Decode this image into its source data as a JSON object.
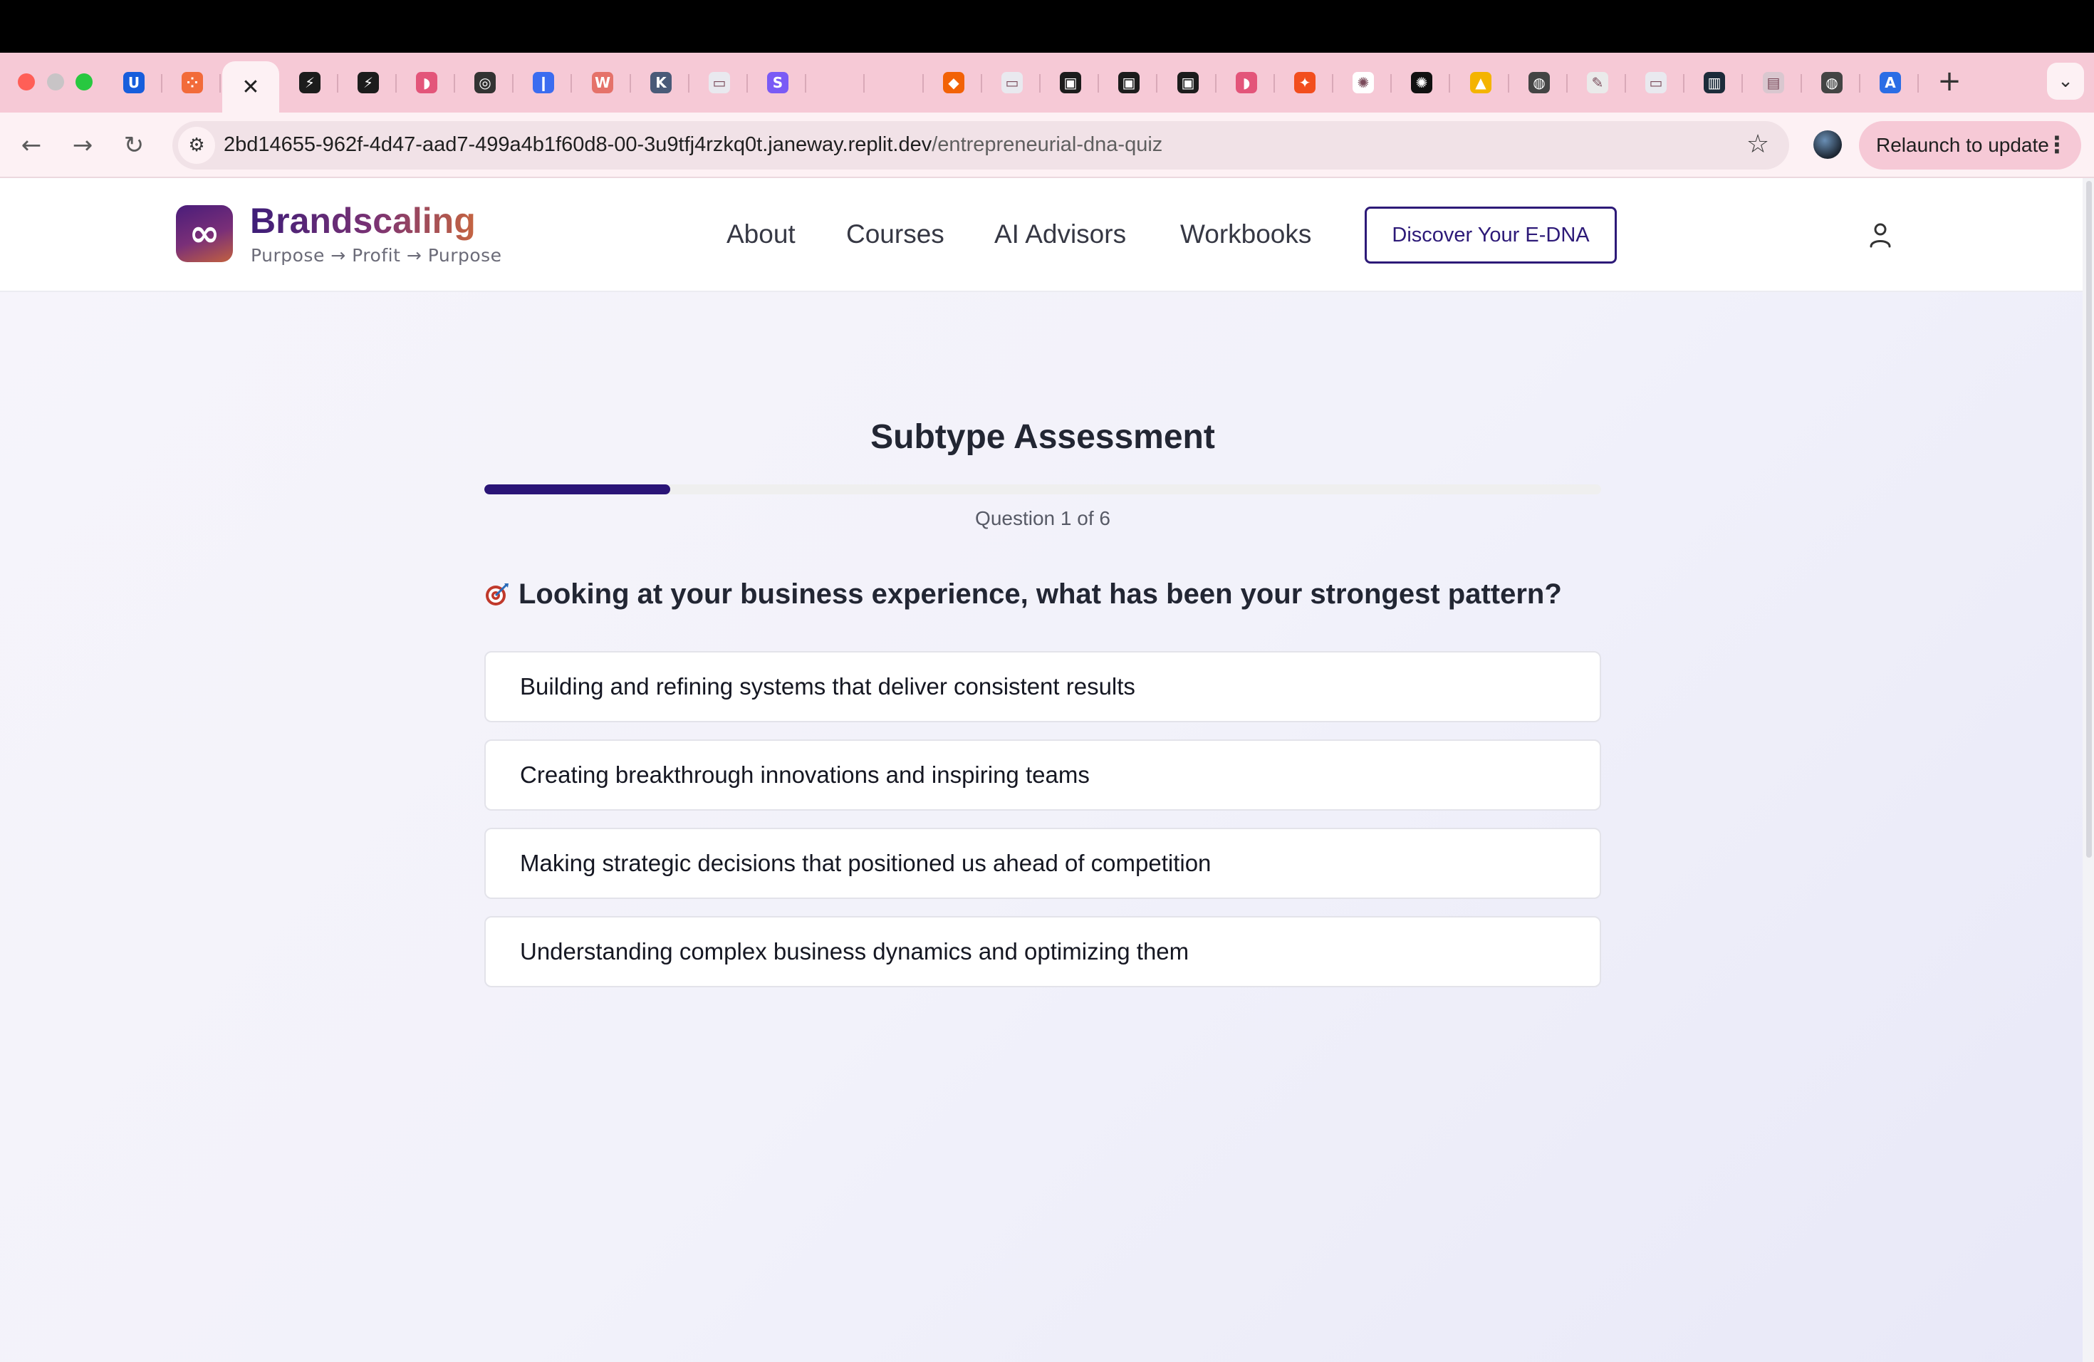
{
  "browser": {
    "tabs": [
      {
        "icon": "bitwarden-icon",
        "color": "#175ddc",
        "glyph": "U"
      },
      {
        "icon": "grid-app-icon",
        "color": "#f26b3a",
        "glyph": "⁘"
      },
      {
        "icon": "close-icon",
        "active": true
      },
      {
        "icon": "bolt-app-icon",
        "color": "#1c1c1c",
        "glyph": "⚡"
      },
      {
        "icon": "bolt-app-icon",
        "color": "#1c1c1c",
        "glyph": "⚡"
      },
      {
        "icon": "shape-app-icon",
        "color": "#e3557a",
        "glyph": "◗"
      },
      {
        "icon": "activity-icon",
        "color": "#333333",
        "glyph": "◎"
      },
      {
        "icon": "pill-app-icon",
        "color": "#3b6cf0",
        "glyph": "❙"
      },
      {
        "icon": "w-app-icon",
        "color": "#e5726a",
        "glyph": "W"
      },
      {
        "icon": "k-app-icon",
        "color": "#4a5a78",
        "glyph": "K"
      },
      {
        "icon": "image-icon",
        "color": "#e9e9ef",
        "glyph": "▭"
      },
      {
        "icon": "s-app-icon",
        "color": "#7a5af5",
        "glyph": "S"
      },
      {
        "icon": "blank-icon",
        "color": "#f6c9d6",
        "glyph": ""
      },
      {
        "icon": "blank-icon",
        "color": "#f6c9d6",
        "glyph": ""
      },
      {
        "icon": "replit-icon",
        "color": "#f26207",
        "glyph": "◆"
      },
      {
        "icon": "image-icon",
        "color": "#e9e9ef",
        "glyph": "▭"
      },
      {
        "icon": "app-icon",
        "color": "#1c1c1c",
        "glyph": "▣"
      },
      {
        "icon": "app-icon",
        "color": "#1c1c1c",
        "glyph": "▣"
      },
      {
        "icon": "app-icon",
        "color": "#1c1c1c",
        "glyph": "▣"
      },
      {
        "icon": "shape-app-icon",
        "color": "#e3557a",
        "glyph": "◗"
      },
      {
        "icon": "figma-icon",
        "color": "#f24e1e",
        "glyph": "✦"
      },
      {
        "icon": "openai-icon",
        "color": "#ffffff",
        "glyph": "✺"
      },
      {
        "icon": "openai-icon",
        "color": "#111111",
        "glyph": "✺"
      },
      {
        "icon": "triangle-app-icon",
        "color": "#f4b400",
        "glyph": "▲"
      },
      {
        "icon": "globe-icon",
        "color": "#444444",
        "glyph": "◍"
      },
      {
        "icon": "edit-icon",
        "color": "#eaeaea",
        "glyph": "✎"
      },
      {
        "icon": "image-icon",
        "color": "#e9e9ef",
        "glyph": "▭"
      },
      {
        "icon": "chart-app-icon",
        "color": "#1c2b3a",
        "glyph": "▥"
      },
      {
        "icon": "image-icon",
        "color": "#d9c7cf",
        "glyph": "▤"
      },
      {
        "icon": "globe-icon",
        "color": "#444444",
        "glyph": "◍"
      },
      {
        "icon": "a-app-icon",
        "color": "#2b6de5",
        "glyph": "A"
      }
    ],
    "new_tab": "+",
    "tab_menu": "⌄",
    "url_host": "2bd14655-962f-4d47-aad7-499a4b1f60d8-00-3u9tfj4rzkq0t.janeway.replit.dev",
    "url_path": "/entrepreneurial-dna-quiz",
    "relaunch_label": "Relaunch to update"
  },
  "site": {
    "brand": "Brandscaling",
    "tagline": "Purpose → Profit → Purpose",
    "nav": [
      "About",
      "Courses",
      "AI Advisors",
      "Workbooks"
    ],
    "cta": "Discover Your E-DNA"
  },
  "quiz": {
    "title": "Subtype Assessment",
    "progress_fraction": 0.1667,
    "counter": "Question 1 of 6",
    "question_emoji": "target-icon",
    "question": "Looking at your business experience, what has been your strongest pattern?",
    "options": [
      "Building and refining systems that deliver consistent results",
      "Creating breakthrough innovations and inspiring teams",
      "Making strategic decisions that positioned us ahead of competition",
      "Understanding complex business dynamics and optimizing them"
    ]
  },
  "colors": {
    "accent": "#2a1477",
    "tab_strip": "#f6c9d6"
  }
}
